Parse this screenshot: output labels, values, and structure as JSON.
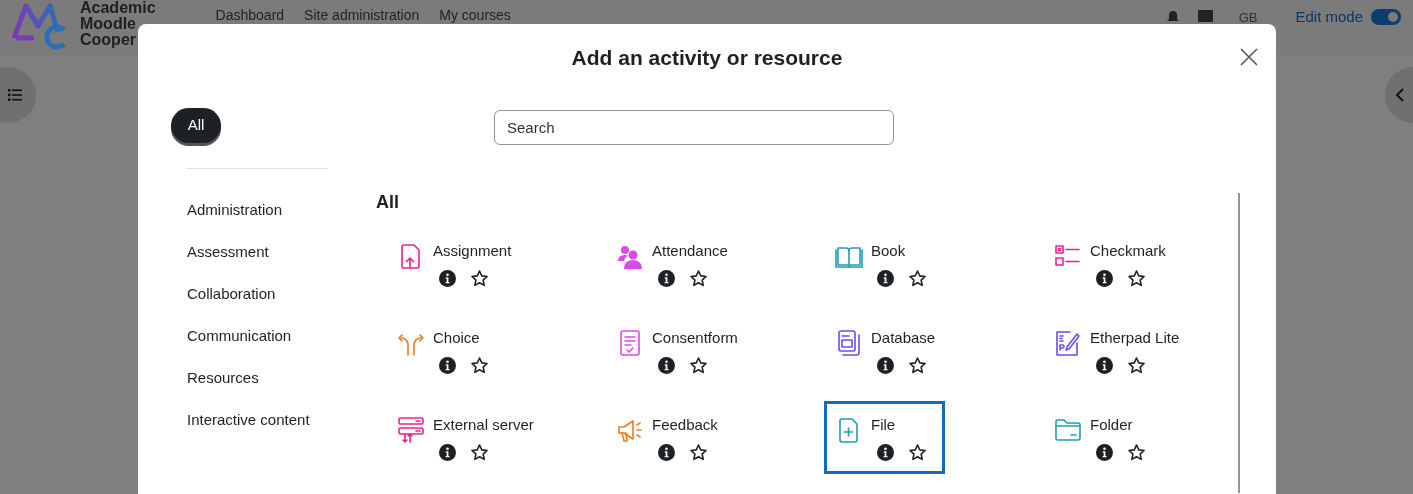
{
  "header": {
    "logo_lines": [
      "Academic",
      "Moodle",
      "Cooper"
    ],
    "nav": [
      "Dashboard",
      "Site administration",
      "My courses"
    ],
    "avatar": "GB",
    "edit_mode": {
      "label": "Edit mode",
      "on": true
    }
  },
  "dialog": {
    "title": "Add an activity or resource",
    "filter": {
      "label": "All",
      "selected": true
    },
    "categories": [
      {
        "label": "Administration",
        "selected": false
      },
      {
        "label": "Assessment",
        "selected": false
      },
      {
        "label": "Collaboration",
        "selected": false
      },
      {
        "label": "Communication",
        "selected": false
      },
      {
        "label": "Resources",
        "selected": false
      },
      {
        "label": "Interactive content",
        "selected": false
      }
    ],
    "search": {
      "placeholder": "Search"
    },
    "section_heading": "All",
    "items": [
      {
        "name": "Assignment",
        "selected": false,
        "starred": false
      },
      {
        "name": "Attendance",
        "selected": false,
        "starred": false
      },
      {
        "name": "Book",
        "selected": false,
        "starred": false
      },
      {
        "name": "Checkmark",
        "selected": false,
        "starred": false
      },
      {
        "name": "Choice",
        "selected": false,
        "starred": false
      },
      {
        "name": "Consentform",
        "selected": false,
        "starred": false
      },
      {
        "name": "Database",
        "selected": false,
        "starred": false
      },
      {
        "name": "Etherpad Lite",
        "selected": false,
        "starred": false
      },
      {
        "name": "External server",
        "selected": false,
        "starred": false
      },
      {
        "name": "Feedback",
        "selected": false,
        "starred": false
      },
      {
        "name": "File",
        "selected": true,
        "starred": false
      },
      {
        "name": "Folder",
        "selected": false,
        "starred": false
      }
    ]
  }
}
